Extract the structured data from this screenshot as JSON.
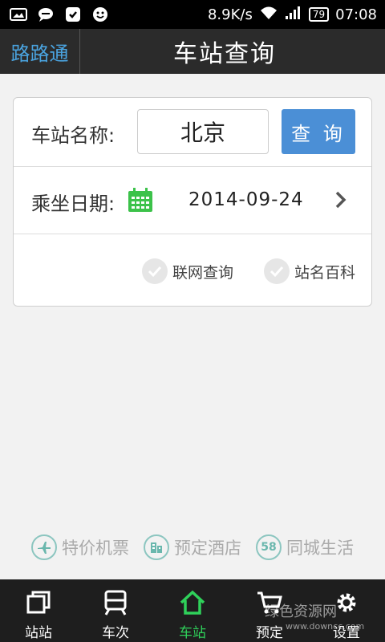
{
  "status_bar": {
    "speed": "8.9K/s",
    "battery": "79",
    "time": "07:08"
  },
  "titlebar": {
    "app_name": "路路通",
    "title": "车站查询"
  },
  "form": {
    "station_label": "车站名称:",
    "station_value": "北京",
    "query_label": "查 询",
    "date_label": "乘坐日期:",
    "date_value": "2014-09-24",
    "option_online": "联网查询",
    "option_encyclopedia": "站名百科"
  },
  "links": [
    {
      "label": "特价机票",
      "icon": "airplane-icon"
    },
    {
      "label": "预定酒店",
      "icon": "hotel-icon"
    },
    {
      "label": "同城生活",
      "icon": "58-icon",
      "badge": "58"
    }
  ],
  "tabs": [
    {
      "label": "站站",
      "icon": "station-to-station-icon",
      "active": false
    },
    {
      "label": "车次",
      "icon": "train-icon",
      "active": false
    },
    {
      "label": "车站",
      "icon": "home-icon",
      "active": true
    },
    {
      "label": "预定",
      "icon": "cart-icon",
      "active": false
    },
    {
      "label": "设置",
      "icon": "gear-icon",
      "active": false
    }
  ],
  "watermark": {
    "line1": "绿色资源网",
    "line2": "www.downcc.com"
  },
  "colors": {
    "accent_blue": "#4b8fd6",
    "active_green": "#2fd15a",
    "app_name_blue": "#4aa3df",
    "link_teal": "#6ab7ad"
  }
}
